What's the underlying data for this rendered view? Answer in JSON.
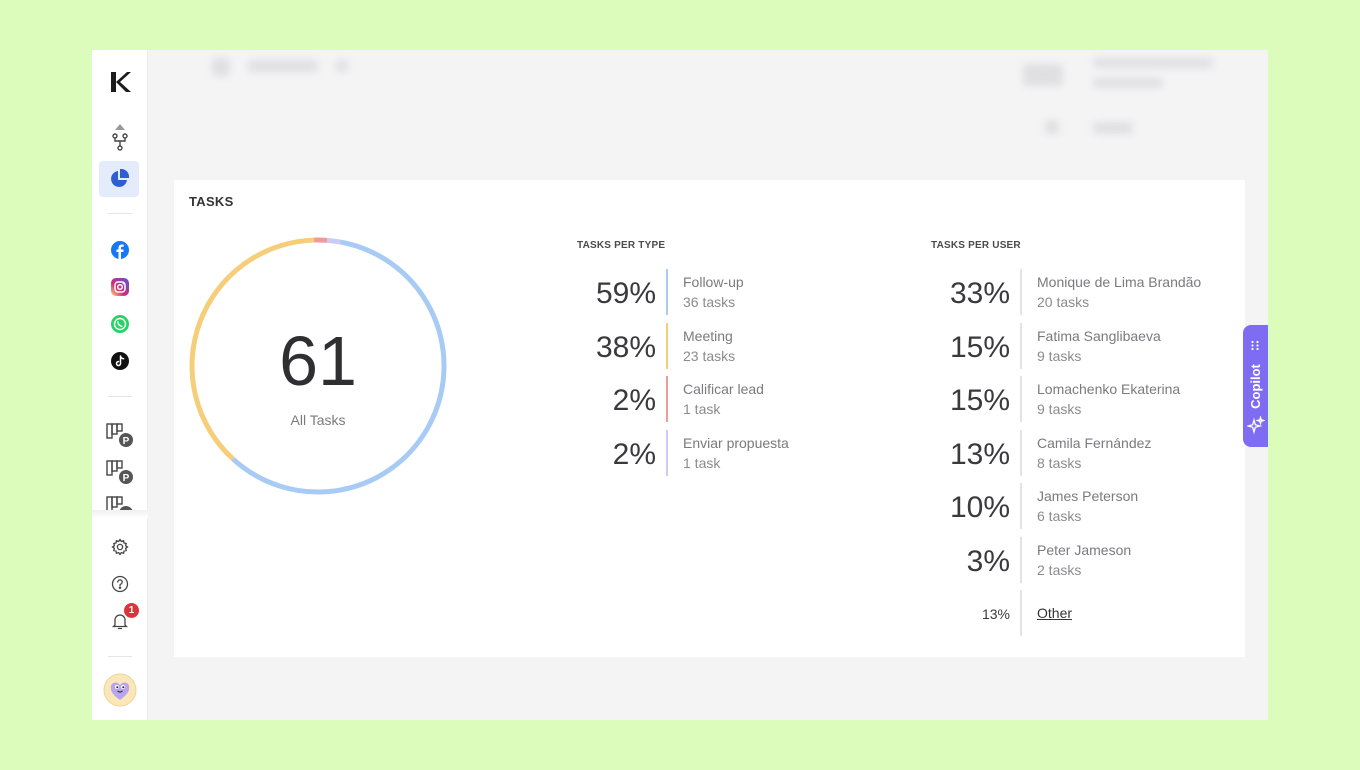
{
  "app": {
    "logo": "logo-icon"
  },
  "sidebar": {
    "items": [
      {
        "icon": "workflow-icon"
      },
      {
        "icon": "pie-chart-icon",
        "active": true
      },
      {
        "icon": "facebook-icon"
      },
      {
        "icon": "instagram-icon"
      },
      {
        "icon": "whatsapp-icon"
      },
      {
        "icon": "tiktok-icon"
      },
      {
        "icon": "pipeline-icon"
      },
      {
        "icon": "pipeline-icon"
      },
      {
        "icon": "pipeline-icon"
      },
      {
        "icon": "gear-icon"
      },
      {
        "icon": "help-icon"
      },
      {
        "icon": "bell-icon"
      }
    ],
    "notifications_badge": "1"
  },
  "tasks": {
    "title": "TASKS",
    "total": "61",
    "total_label": "All Tasks",
    "per_type_title": "TASKS PER TYPE",
    "per_user_title": "TASKS PER USER",
    "per_type": [
      {
        "pct": "59%",
        "name": "Follow-up",
        "count": "36 tasks",
        "color": "#a8cbf5"
      },
      {
        "pct": "38%",
        "name": "Meeting",
        "count": "23 tasks",
        "color": "#f6ce7a"
      },
      {
        "pct": "2%",
        "name": "Calificar lead",
        "count": "1 task",
        "color": "#ef9b9b"
      },
      {
        "pct": "2%",
        "name": "Enviar propuesta",
        "count": "1 task",
        "color": "#cfc9f5"
      }
    ],
    "per_user": [
      {
        "pct": "33%",
        "name": "Monique de Lima Brandão",
        "count": "20 tasks"
      },
      {
        "pct": "15%",
        "name": "Fatima Sanglibaeva",
        "count": "9 tasks"
      },
      {
        "pct": "15%",
        "name": "Lomachenko Ekaterina",
        "count": "9 tasks"
      },
      {
        "pct": "13%",
        "name": "Camila Fernández",
        "count": "8 tasks"
      },
      {
        "pct": "10%",
        "name": "James Peterson",
        "count": "6 tasks"
      },
      {
        "pct": "3%",
        "name": "Peter Jameson",
        "count": "2 tasks"
      }
    ],
    "other": {
      "pct": "13%",
      "label": "Other"
    },
    "donut_segments": [
      {
        "value": 36,
        "color": "#a8cbf5"
      },
      {
        "value": 23,
        "color": "#f6ce7a"
      },
      {
        "value": 1,
        "color": "#ef9b9b"
      },
      {
        "value": 1,
        "color": "#cfc9f5"
      }
    ]
  },
  "copilot": {
    "label": "Copilot"
  }
}
